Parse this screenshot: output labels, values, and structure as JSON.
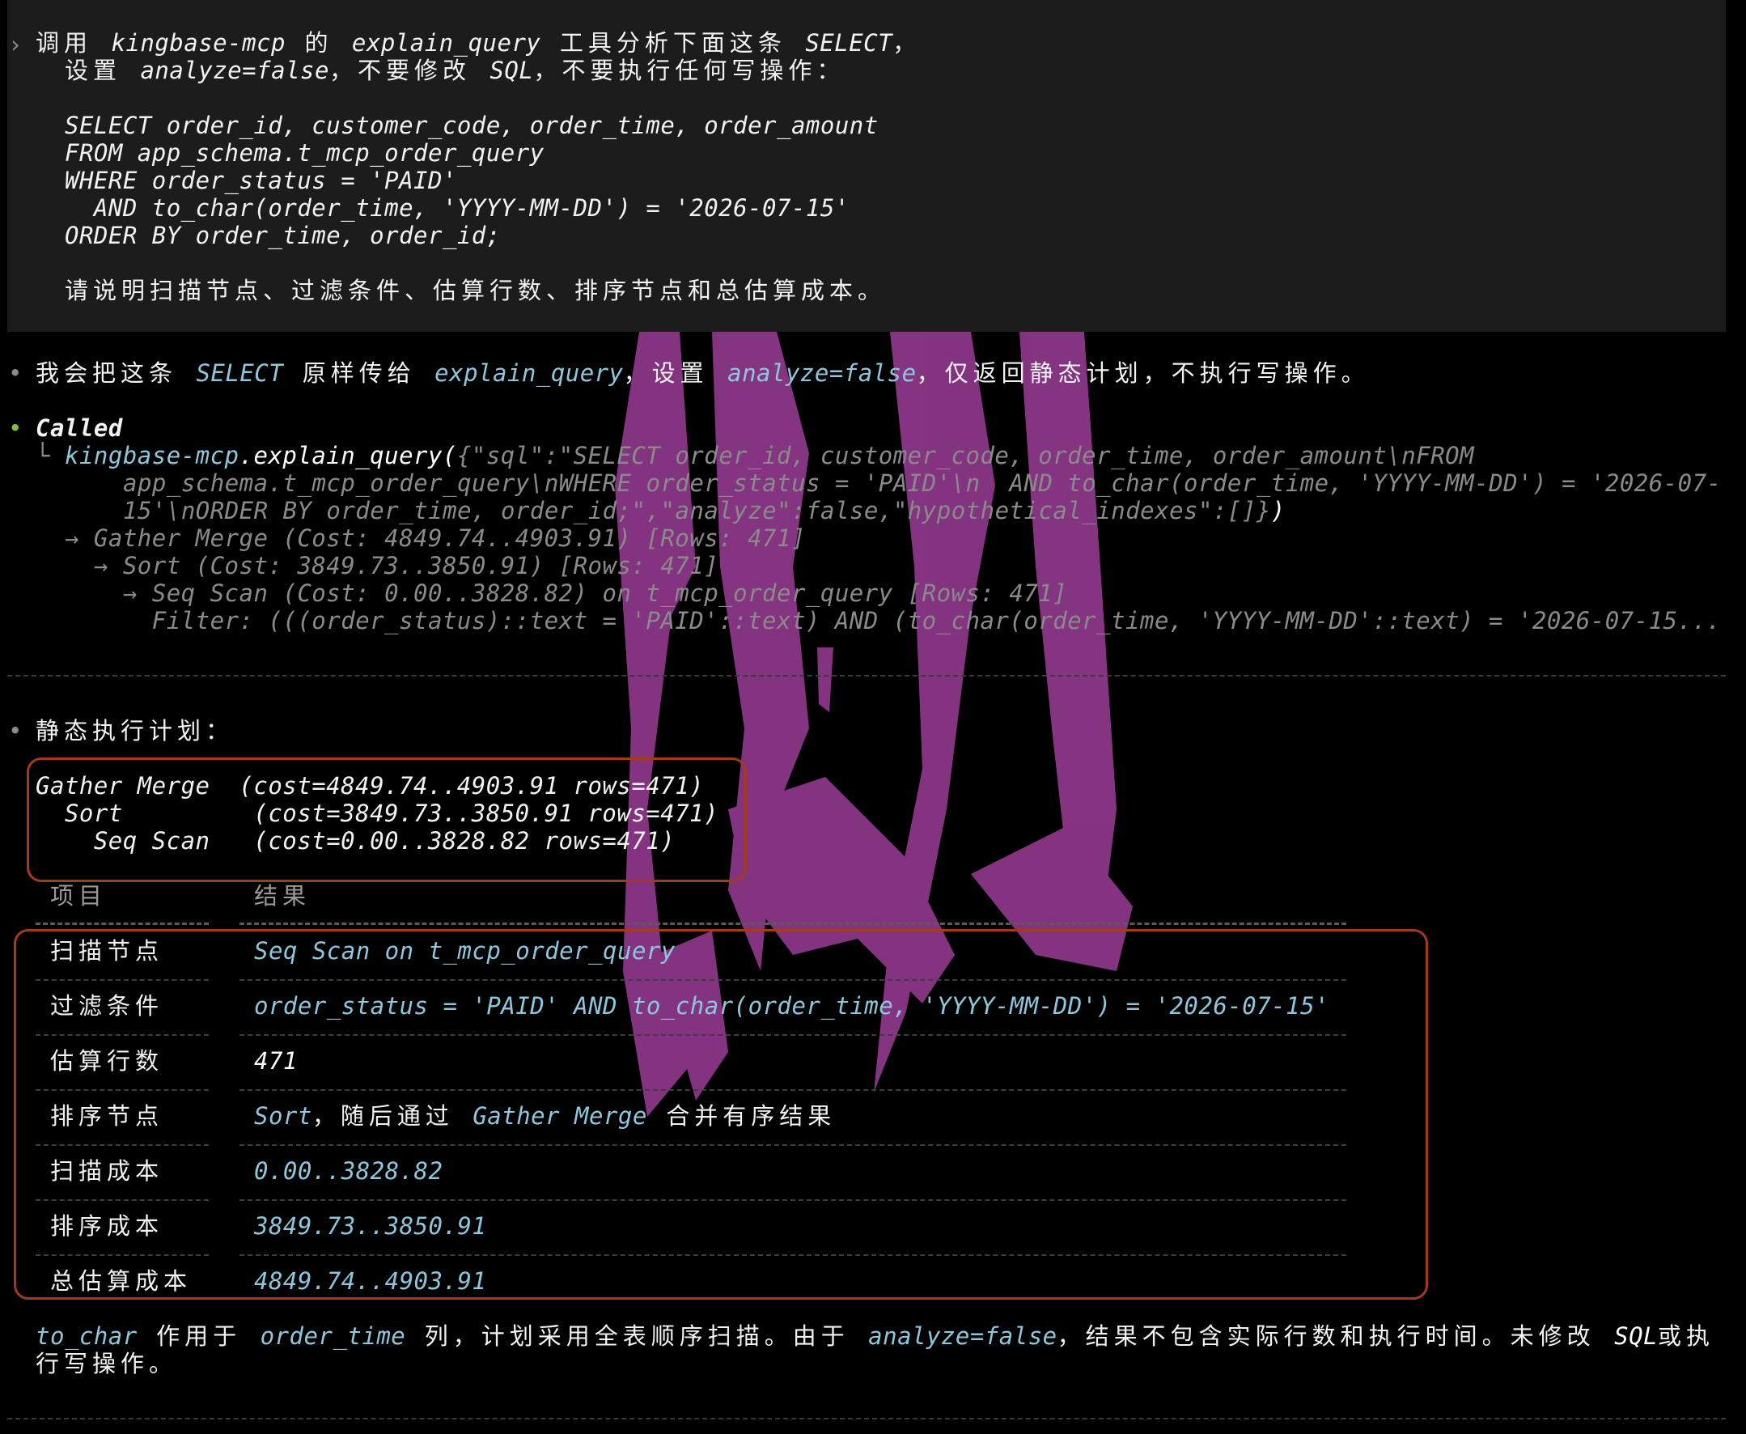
{
  "prompt": {
    "line1_parts": [
      {
        "t": "调用 ",
        "s": "cjk"
      },
      {
        "t": "kingbase-mcp",
        "s": "it"
      },
      {
        "t": " 的 ",
        "s": "cjk"
      },
      {
        "t": "explain_query",
        "s": "it"
      },
      {
        "t": " 工具分析下面这条 ",
        "s": "cjk"
      },
      {
        "t": "SELECT",
        "s": "it"
      },
      {
        "t": "，",
        "s": "cjk"
      }
    ],
    "line2_parts": [
      {
        "t": "设置 ",
        "s": "cjk"
      },
      {
        "t": "analyze=false",
        "s": "it"
      },
      {
        "t": "，不要修改 ",
        "s": "cjk"
      },
      {
        "t": "SQL",
        "s": "it"
      },
      {
        "t": "，不要执行任何写操作：",
        "s": "cjk"
      }
    ],
    "sql_lines": [
      "SELECT order_id, customer_code, order_time, order_amount",
      "FROM app_schema.t_mcp_order_query",
      "WHERE order_status = 'PAID'",
      "  AND to_char(order_time, 'YYYY-MM-DD') = '2026-07-15'",
      "ORDER BY order_time, order_id;"
    ],
    "request": "请说明扫描节点、过滤条件、估算行数、排序节点和总估算成本。"
  },
  "assistant_intro_parts": [
    {
      "t": "我会把这条 ",
      "s": "cjk"
    },
    {
      "t": "SELECT",
      "s": "cyan"
    },
    {
      "t": " 原样传给 ",
      "s": "cjk"
    },
    {
      "t": "explain_query",
      "s": "cyan"
    },
    {
      "t": "，设置 ",
      "s": "cjk"
    },
    {
      "t": "analyze=false",
      "s": "cyan"
    },
    {
      "t": "，仅返回静态计划，不执行写操作。",
      "s": "cjk"
    }
  ],
  "tool_call": {
    "status": "Called",
    "server": "kingbase-mcp",
    "method": ".explain_query",
    "open": "(",
    "args_line1": "{\"sql\":\"SELECT order_id, customer_code, order_time, order_amount\\nFROM",
    "args_line2": "app_schema.t_mcp_order_query\\nWHERE order_status = 'PAID'\\n  AND to_char(order_time, 'YYYY-MM-DD') = '2026-07-",
    "args_line3": "15'\\nORDER BY order_time, order_id;\",\"analyze\":false,\"hypothetical_indexes\":[]}",
    "close": ")",
    "result_lines": [
      "→ Gather Merge (Cost: 4849.74..4903.91) [Rows: 471]",
      "  → Sort (Cost: 3849.73..3850.91) [Rows: 471]",
      "    → Seq Scan (Cost: 0.00..3828.82) on t_mcp_order_query [Rows: 471]",
      "      Filter: (((order_status)::text = 'PAID'::text) AND (to_char(order_time, 'YYYY-MM-DD'::text) = '2026-07-15..."
    ]
  },
  "plan_heading": "静态执行计划：",
  "plan_lines": [
    "Gather Merge  (cost=4849.74..4903.91 rows=471)",
    "  Sort         (cost=3849.73..3850.91 rows=471)",
    "    Seq Scan   (cost=0.00..3828.82 rows=471)"
  ],
  "table": {
    "headers": [
      "项目",
      "结果"
    ],
    "rows": [
      {
        "label": "扫描节点",
        "value": [
          {
            "t": "Seq Scan on t_mcp_order_query",
            "s": "cyan"
          }
        ]
      },
      {
        "label": "过滤条件",
        "value": [
          {
            "t": "order_status = 'PAID' AND to_char(order_time, 'YYYY-MM-DD') = '2026-07-15'",
            "s": "cyan"
          }
        ]
      },
      {
        "label": "估算行数",
        "value": [
          {
            "t": "471",
            "s": "white-it"
          }
        ]
      },
      {
        "label": "排序节点",
        "value": [
          {
            "t": "Sort",
            "s": "cyan"
          },
          {
            "t": "，随后通过 ",
            "s": "cjk"
          },
          {
            "t": "Gather Merge",
            "s": "cyan"
          },
          {
            "t": " 合并有序结果",
            "s": "cjk"
          }
        ]
      },
      {
        "label": "扫描成本",
        "value": [
          {
            "t": "0.00..3828.82",
            "s": "cyan"
          }
        ]
      },
      {
        "label": "排序成本",
        "value": [
          {
            "t": "3849.73..3850.91",
            "s": "cyan"
          }
        ]
      },
      {
        "label": "总估算成本",
        "value": [
          {
            "t": "4849.74..4903.91",
            "s": "cyan"
          }
        ]
      }
    ]
  },
  "summary_line1_parts": [
    {
      "t": "to_char",
      "s": "cyan"
    },
    {
      "t": " 作用于 ",
      "s": "cjk"
    },
    {
      "t": "order_time",
      "s": "cyan"
    },
    {
      "t": " 列，计划采用全表顺序扫描。由于 ",
      "s": "cjk"
    },
    {
      "t": "analyze=false",
      "s": "cyan"
    },
    {
      "t": "，结果不包含实际行数和执行时间。未修改 ",
      "s": "cjk"
    },
    {
      "t": "SQL",
      "s": "white-it"
    },
    {
      "t": "或执",
      "s": "cjk"
    }
  ],
  "summary_line2": "行写操作。",
  "colors": {
    "accent_cyan": "#8ec7dc",
    "highlight_box": "#a43a1a",
    "bullet_green": "#7fc23a",
    "art_magenta": "#9b3d96"
  }
}
